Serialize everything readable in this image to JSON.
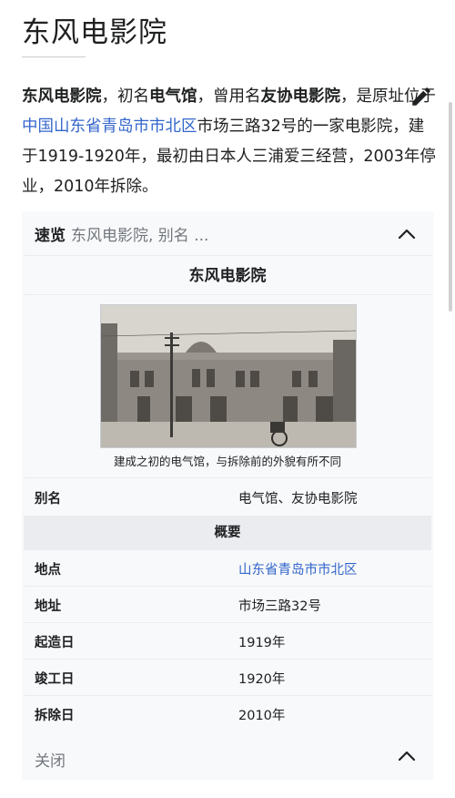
{
  "page": {
    "title": "东风电影院"
  },
  "intro": {
    "name_bold": "东风电影院",
    "t1": "，初名",
    "alias1_bold": "电气馆",
    "t2": "，曾用名",
    "alias2_bold": "友协电影院",
    "t3": "，是原址位于",
    "location_link": "中国山东省青岛市市北区",
    "t4": "市场三路32号的一家电影院，建于1919-1920年，最初由日本人三浦爱三经营，2003年停业，2010年拆除。"
  },
  "infobox": {
    "header_label": "速览",
    "header_preview": "东风电影院, 别名 ...",
    "name": "东风电影院",
    "caption": "建成之初的电气馆，与拆除前的外貌有所不同",
    "alias_row": {
      "key": "别名",
      "value": "电气馆、友协电影院"
    },
    "section_title": "概要",
    "rows": [
      {
        "key": "地点",
        "value": "山东省青岛市市北区"
      },
      {
        "key": "地址",
        "value": "市场三路32号"
      },
      {
        "key": "起造日",
        "value": "1919年"
      },
      {
        "key": "竣工日",
        "value": "1920年"
      },
      {
        "key": "拆除日",
        "value": "2010年"
      }
    ],
    "close_label": "关闭"
  },
  "icons": {
    "edit": "pencil-icon",
    "collapse": "chevron-up-icon"
  },
  "colors": {
    "link": "#3366cc",
    "muted": "#72777d",
    "infobox_bg": "#f8f9fa",
    "section_bg": "#eaecf0"
  }
}
